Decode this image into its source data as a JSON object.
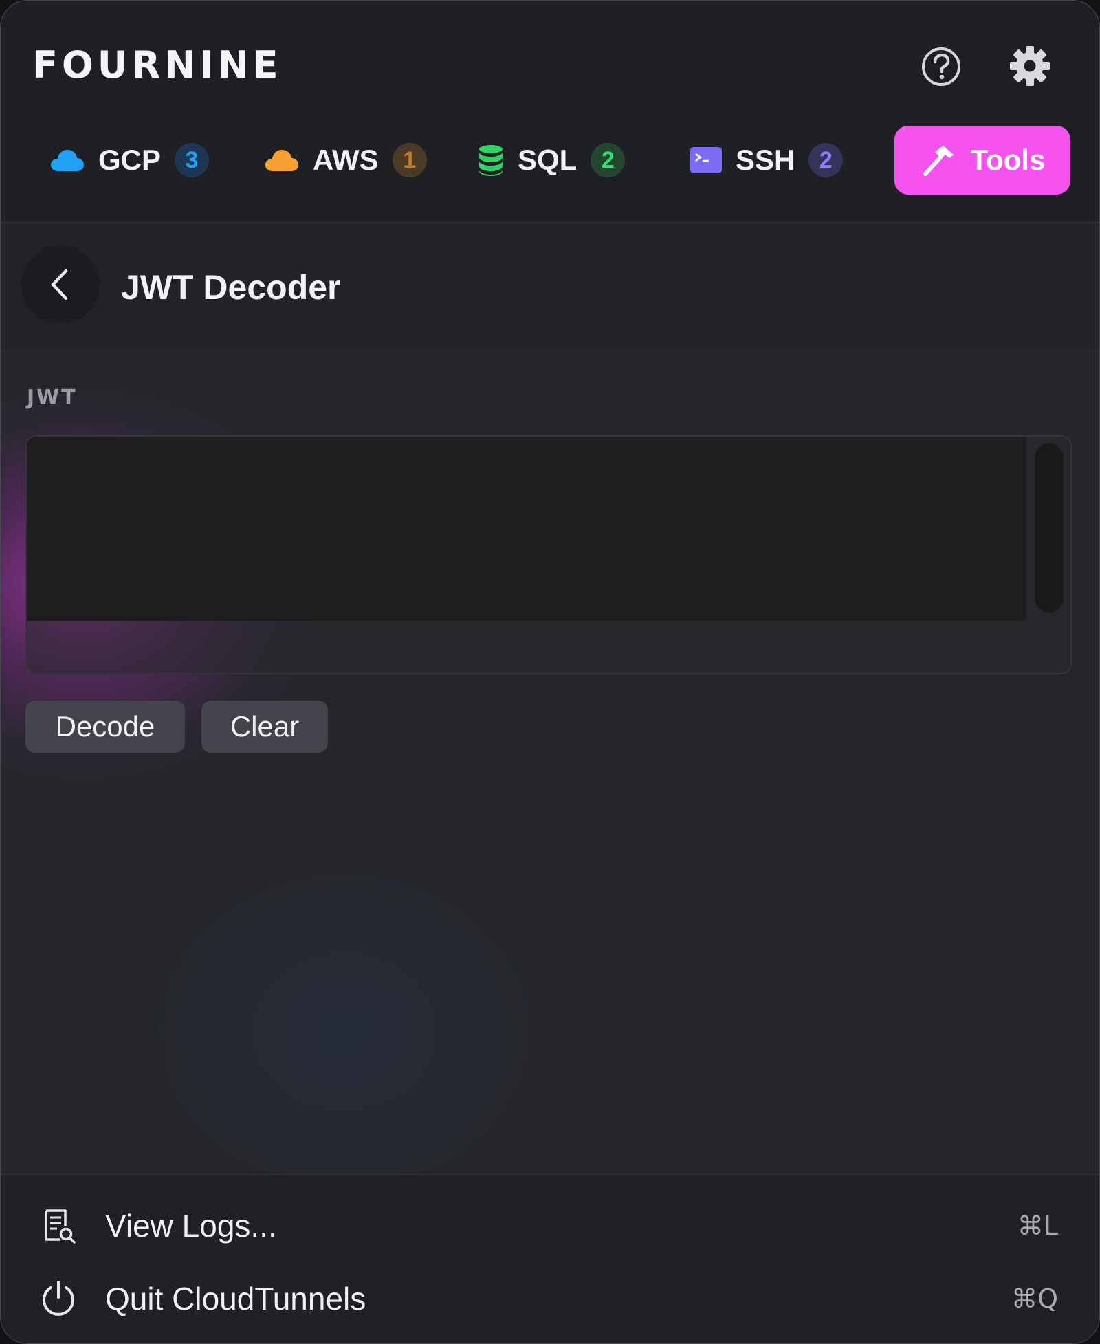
{
  "app": {
    "brand": "FOURNINE",
    "icons": {
      "help": "help-circle-icon",
      "settings": "gear-icon"
    }
  },
  "tabs": [
    {
      "label": "GCP",
      "badge": "3",
      "icon": "cloud-icon",
      "color": "#1fa2f6",
      "badge_bg": "#1f3554",
      "badge_fg": "#1fa2f6"
    },
    {
      "label": "AWS",
      "badge": "1",
      "icon": "cloud-icon",
      "color": "#f6a132",
      "badge_bg": "#4a3a26",
      "badge_fg": "#c07a2a"
    },
    {
      "label": "SQL",
      "badge": "2",
      "icon": "database-icon",
      "color": "#30d166",
      "badge_bg": "#234631",
      "badge_fg": "#33e06e"
    },
    {
      "label": "SSH",
      "badge": "2",
      "icon": "terminal-icon",
      "color": "#7c6cf4",
      "badge_bg": "#35325c",
      "badge_fg": "#8d7ff7"
    },
    {
      "label": "Tools",
      "badge": "",
      "icon": "hammer-icon",
      "color": "#f552f0",
      "active": true
    }
  ],
  "tool": {
    "title": "JWT Decoder",
    "field_label": "JWT",
    "input_value": "",
    "decode_label": "Decode",
    "clear_label": "Clear"
  },
  "footer": {
    "items": [
      {
        "label": "View Logs...",
        "shortcut": "⌘L",
        "icon": "logs-search-icon"
      },
      {
        "label": "Quit CloudTunnels",
        "shortcut": "⌘Q",
        "icon": "power-icon"
      }
    ]
  },
  "colors": {
    "accent": "#f552f0",
    "background": "#25262a"
  }
}
